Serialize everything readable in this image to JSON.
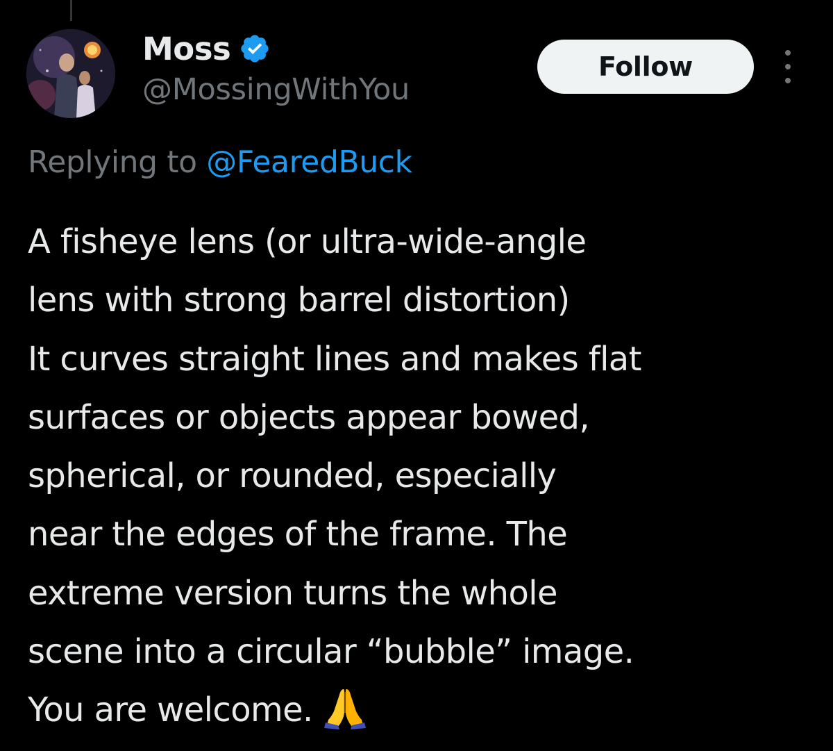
{
  "tweet": {
    "author": {
      "display_name": "Moss",
      "handle": "@MossingWithYou",
      "verified": true,
      "verified_color": "#1d9bf0"
    },
    "follow_label": "Follow",
    "reply_prefix": "Replying to ",
    "reply_to": "@FearedBuck",
    "text_lines": [
      "A fisheye lens (or ultra-wide-angle",
      "lens with strong barrel distortion)",
      "It curves straight lines and makes flat",
      "surfaces or objects appear bowed,",
      "spherical, or rounded, especially",
      "near the edges of the frame. The",
      "extreme version turns the whole",
      "scene into a circular “bubble” image.",
      "You are welcome."
    ],
    "emoji": "folded-hands-icon"
  },
  "colors": {
    "background": "#000000",
    "text_primary": "#e7e9ea",
    "text_secondary": "#71767b",
    "link": "#1d9bf0",
    "follow_bg": "#eff3f4"
  }
}
